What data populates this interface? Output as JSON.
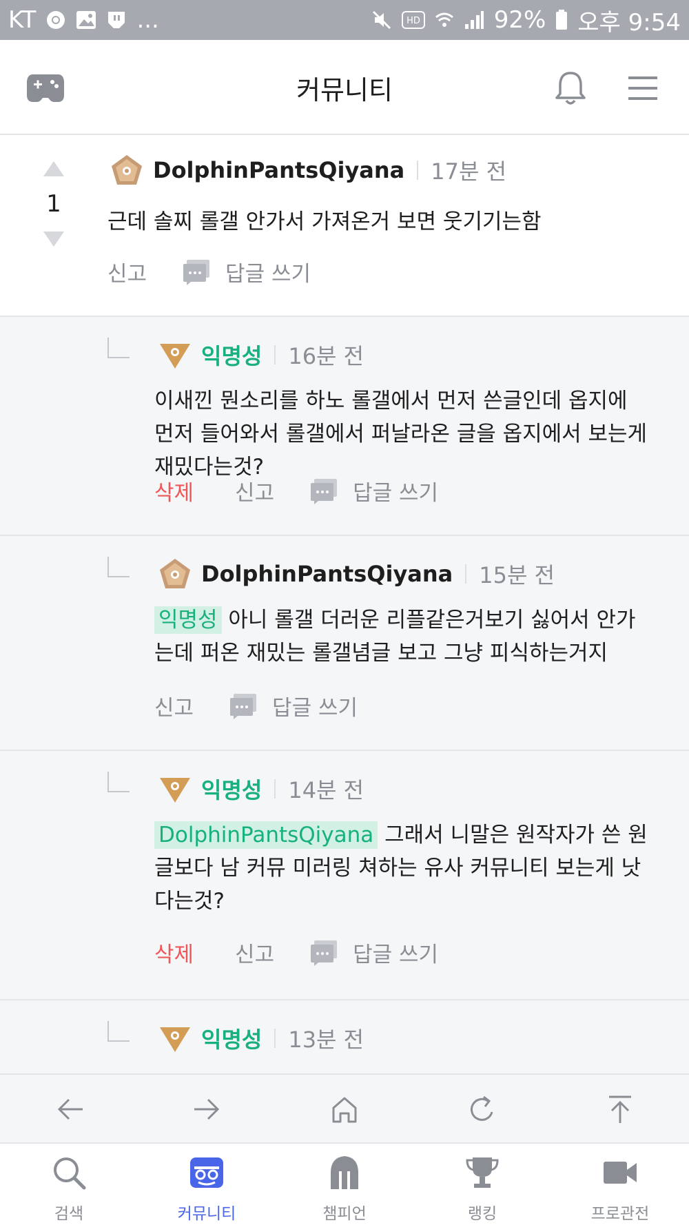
{
  "status_bar": {
    "carrier": "KT",
    "more": "...",
    "battery": "92%",
    "time": "오후 9:54",
    "icons": [
      "chrome-icon",
      "gallery-icon",
      "twitch-icon",
      "mute-icon",
      "hd-icon",
      "wifi-icon",
      "signal-icon",
      "battery-icon"
    ]
  },
  "header": {
    "title": "커뮤니티",
    "left_icon": "gamepad-icon",
    "right_icons": [
      "bell-icon",
      "menu-icon"
    ]
  },
  "comments": [
    {
      "type": "root",
      "author": "DolphinPantsQiyana",
      "time": "17분 전",
      "votes": "1",
      "text": "근데 솔찌 롤갤 안가서 가져온거 보면 웃기기는함",
      "actions": {
        "report": "신고",
        "reply": "답글 쓰기"
      }
    },
    {
      "type": "reply",
      "author": "익명성",
      "time": "16분 전",
      "lines": [
        "이새낀 뭔소리를 하노 롤갤에서 먼저 쓴글인데 옵지에",
        "먼저 들어와서 롤갤에서 퍼날라온 글을 옵지에서 보는게",
        "재밌다는것?"
      ],
      "actions": {
        "delete": "삭제",
        "report": "신고",
        "reply": "답글 쓰기"
      }
    },
    {
      "type": "reply",
      "author": "DolphinPantsQiyana",
      "time": "15분 전",
      "mention": "익명성",
      "lines": [
        " 아니 롤갤 더러운 리플같은거보기 싫어서 안가",
        "는데 퍼온 재밌는 롤갤념글 보고 그냥 피식하는거지"
      ],
      "actions": {
        "report": "신고",
        "reply": "답글 쓰기"
      }
    },
    {
      "type": "reply",
      "author": "익명성",
      "time": "14분 전",
      "mention": "DolphinPantsQiyana",
      "lines": [
        " 그래서 니말은 원작자가 쓴 원",
        "글보다 남 커뮤 미러링 쳐하는 유사 커뮤니티 보는게 낫",
        "다는것?"
      ],
      "actions": {
        "delete": "삭제",
        "report": "신고",
        "reply": "답글 쓰기"
      }
    },
    {
      "type": "reply",
      "author": "익명성",
      "time": "13분 전"
    }
  ],
  "browser_nav": [
    "back-arrow-icon",
    "forward-arrow-icon",
    "home-icon",
    "refresh-icon",
    "scroll-top-icon"
  ],
  "tabs": [
    {
      "label": "검색",
      "icon": "search-icon",
      "active": false
    },
    {
      "label": "커뮤니티",
      "icon": "community-icon",
      "active": true
    },
    {
      "label": "챔피언",
      "icon": "champion-helmet-icon",
      "active": false
    },
    {
      "label": "랭킹",
      "icon": "trophy-icon",
      "active": false
    },
    {
      "label": "프로관전",
      "icon": "video-camera-icon",
      "active": false
    }
  ],
  "colors": {
    "accent_green": "#17b07e",
    "delete_red": "#ee5757",
    "active_tab_blue": "#4a66e8",
    "status_bar_gray": "#a6a9b0"
  }
}
